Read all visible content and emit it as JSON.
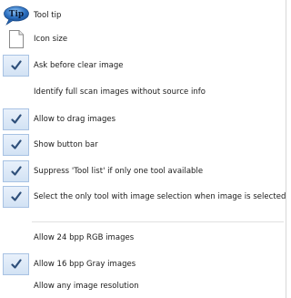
{
  "colors": {
    "check_bg": "#dce8f6",
    "check_border": "#a8c2e3",
    "check_mark": "#2e4f7a",
    "tip_bubble": "#2b6fc0",
    "separator": "#e0e0e0"
  },
  "menu": {
    "items": [
      {
        "label": "Tool tip",
        "icon": "tip-bubble-icon",
        "checked": false
      },
      {
        "label": "Icon size",
        "icon": "page-icon",
        "checked": false
      },
      {
        "label": "Ask before clear image",
        "checked": true
      },
      {
        "label": "Identify full scan images without source info",
        "checked": false
      },
      {
        "label": "Allow to drag images",
        "checked": true
      },
      {
        "label": "Show button bar",
        "checked": true
      },
      {
        "label": "Suppress 'Tool list' if only one tool available",
        "checked": true
      },
      {
        "label": "Select the only tool with image selection when image is selected",
        "checked": true
      },
      {
        "label": "Allow 24 bpp RGB images",
        "checked": false
      },
      {
        "label": "Allow 16 bpp Gray images",
        "checked": true
      },
      {
        "label": "Allow any image resolution",
        "checked": false
      }
    ],
    "tip_icon_text": "Tip"
  }
}
